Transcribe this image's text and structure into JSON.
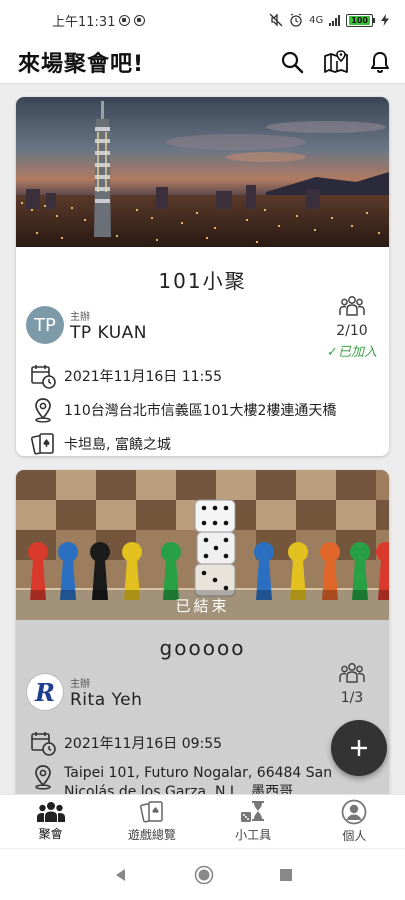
{
  "status_bar": {
    "time": "上午11:31",
    "network": "4G",
    "battery": "100"
  },
  "app_bar": {
    "title": "來場聚會吧!"
  },
  "events": [
    {
      "title": "101小聚",
      "host_role": "主辦",
      "host_name": "TP KUAN",
      "host_initials": "TP",
      "members": "2/10",
      "joined": "✓已加入",
      "datetime": "2021年11月16日 11:55",
      "location": "110台灣台北市信義區101大樓2樓連通天橋",
      "games": "卡坦島, 富饒之城"
    },
    {
      "title": "gooooo",
      "status": "已結束",
      "host_role": "主辦",
      "host_name": "Rita Yeh",
      "host_initials": "R",
      "members": "1/3",
      "datetime": "2021年11月16日 09:55",
      "location": "Taipei 101, Futuro Nogalar, 66484 San Nicolás de los Garza, N.L., 墨西哥"
    }
  ],
  "fab": {
    "icon": "plus-icon",
    "label": "+"
  },
  "bottom_nav": [
    {
      "label": "聚會",
      "icon": "people-icon",
      "active": true
    },
    {
      "label": "遊戲總覽",
      "icon": "cards-icon",
      "active": false
    },
    {
      "label": "小工具",
      "icon": "hourglass-dice-icon",
      "active": false
    },
    {
      "label": "個人",
      "icon": "person-icon",
      "active": false
    }
  ],
  "colors": {
    "joined": "#3ea34a",
    "avatar_tp": "#7c9aa7",
    "fab": "#333333"
  }
}
